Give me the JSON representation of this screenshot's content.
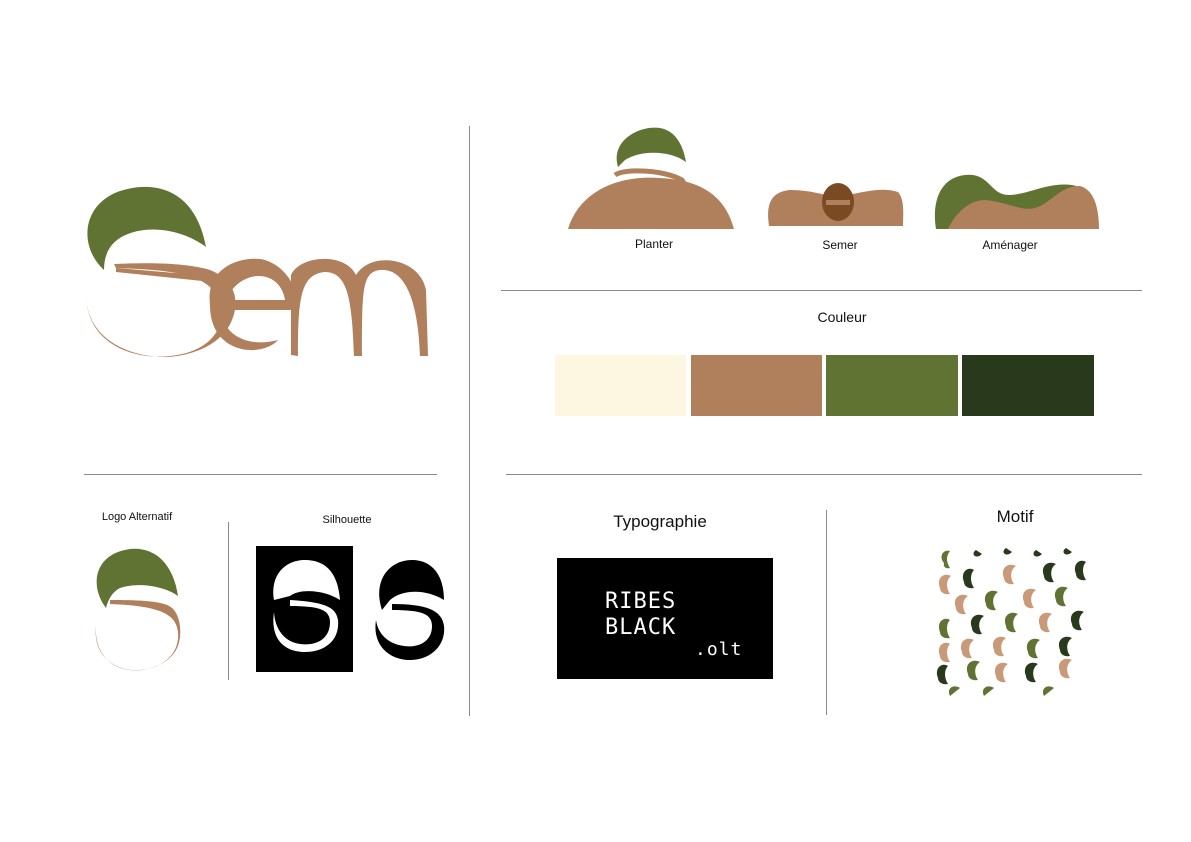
{
  "brand": {
    "wordmark": "Sem"
  },
  "icons": {
    "planter": "Planter",
    "semer": "Semer",
    "amenager": "Aménager"
  },
  "sections": {
    "couleur": "Couleur",
    "logo_alternatif": "Logo Alternatif",
    "silhouette": "Silhouette",
    "typographie": "Typographie",
    "motif": "Motif"
  },
  "typography": {
    "line1": "RIBES",
    "line2": "BLACK",
    "suffix": ".olt"
  },
  "palette": {
    "cream": "#fdf7e1",
    "brown": "#b07f5c",
    "green": "#617333",
    "dark_green": "#29391c"
  }
}
